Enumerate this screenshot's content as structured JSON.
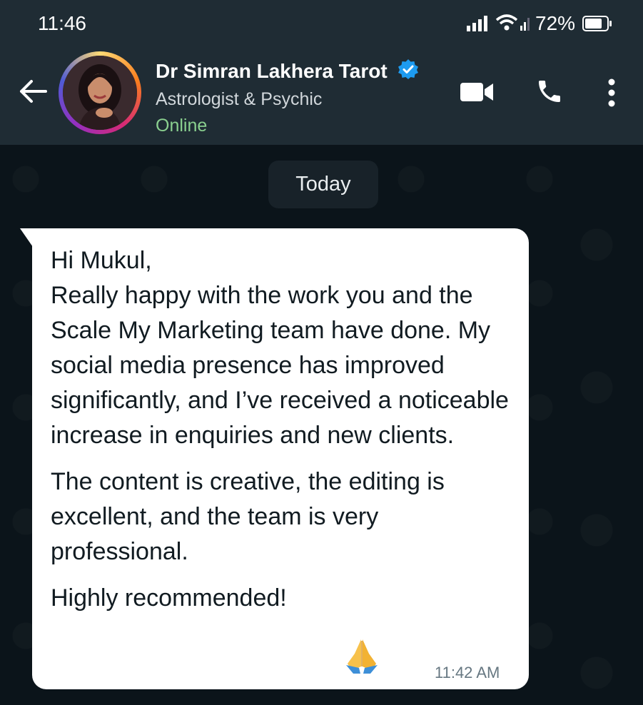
{
  "status_bar": {
    "time": "11:46",
    "battery": "72%"
  },
  "contact": {
    "name": "Dr Simran Lakhera Tarot",
    "subtitle": "Astrologist & Psychic",
    "status": "Online"
  },
  "chat": {
    "date_chip": "Today",
    "message": {
      "greeting": "Hi Mukul,",
      "paragraph1": "Really happy with the work you and the Scale My Marketing team have done. My social media presence has improved significantly, and I’ve received a noticeable increase in enquiries and new clients.",
      "paragraph2": "The content is creative, the editing is excellent, and the team is very professional.",
      "closing": "Highly recommended!",
      "time": "11:42 AM"
    }
  },
  "icons": {
    "back": "arrow-left-icon",
    "verified": "verified-badge-icon",
    "video": "video-call-icon",
    "call": "phone-icon",
    "menu": "more-vertical-icon",
    "emoji": "folded-hands-icon"
  },
  "colors": {
    "header_bg": "#1f2c34",
    "chat_bg": "#0b141a",
    "online": "#8ad08f",
    "verified": "#1d9bf0",
    "bubble": "#ffffff"
  }
}
